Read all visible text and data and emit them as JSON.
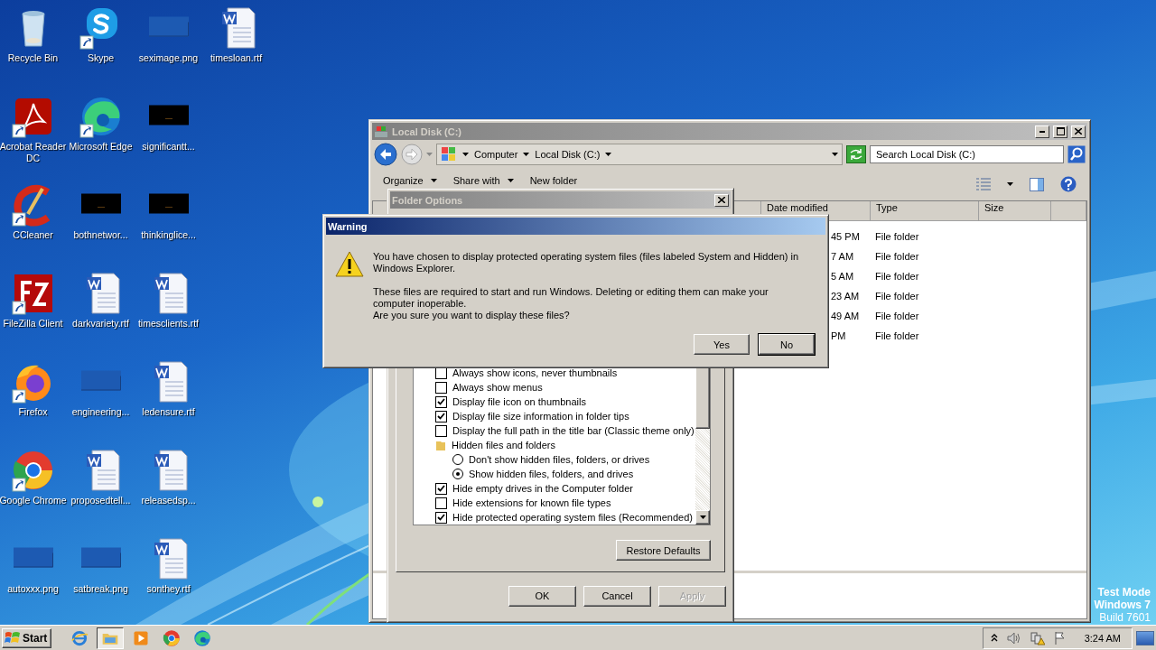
{
  "desktop": {
    "icons": [
      [
        {
          "kind": "recycle",
          "label": "Recycle Bin",
          "shortcut": false
        },
        {
          "kind": "acrobat",
          "label": "Acrobat Reader DC",
          "shortcut": true
        },
        {
          "kind": "ccleaner",
          "label": "CCleaner",
          "shortcut": true
        },
        {
          "kind": "filezilla",
          "label": "FileZilla Client",
          "shortcut": true
        },
        {
          "kind": "firefox",
          "label": "Firefox",
          "shortcut": true
        },
        {
          "kind": "chrome",
          "label": "Google Chrome",
          "shortcut": true
        },
        {
          "kind": "image-blank",
          "label": "autoxxx.png",
          "shortcut": false
        }
      ],
      [
        {
          "kind": "skype",
          "label": "Skype",
          "shortcut": true
        },
        {
          "kind": "edge",
          "label": "Microsoft Edge",
          "shortcut": true
        },
        {
          "kind": "image-dark",
          "label": "bothnetwor...",
          "shortcut": false
        },
        {
          "kind": "word",
          "label": "darkvariety.rtf",
          "shortcut": false
        },
        {
          "kind": "image-blank",
          "label": "engineering...",
          "shortcut": false
        },
        {
          "kind": "word",
          "label": "proposedtell...",
          "shortcut": false
        },
        {
          "kind": "image-blank",
          "label": "satbreak.png",
          "shortcut": false
        }
      ],
      [
        {
          "kind": "image-blank",
          "label": "seximage.png",
          "shortcut": false
        },
        {
          "kind": "image-dark",
          "label": "significantt...",
          "shortcut": false
        },
        {
          "kind": "image-dark",
          "label": "thinkinglice...",
          "shortcut": false
        },
        {
          "kind": "word",
          "label": "timesclients.rtf",
          "shortcut": false
        },
        {
          "kind": "word",
          "label": "ledensure.rtf",
          "shortcut": false
        },
        {
          "kind": "word",
          "label": "releasedsp...",
          "shortcut": false
        },
        {
          "kind": "word",
          "label": "sonthey.rtf",
          "shortcut": false
        }
      ],
      [
        {
          "kind": "word",
          "label": "timesloan.rtf",
          "shortcut": false
        }
      ]
    ]
  },
  "system_notice": [
    {
      "text": "Test Mode",
      "bold": true
    },
    {
      "text": "Windows 7",
      "bold": true
    },
    {
      "text": "Build 7601",
      "bold": false
    }
  ],
  "explorer": {
    "title": "Local Disk (C:)",
    "breadcrumb": [
      "Computer",
      "Local Disk (C:)"
    ],
    "search": {
      "placeholder": "Search Local Disk (C:)"
    },
    "toolbar": [
      {
        "label": "Organize",
        "dropdown": true
      },
      {
        "label": "Share with",
        "dropdown": true
      },
      {
        "label": "New folder",
        "dropdown": false
      }
    ],
    "columns": [
      "Date modified",
      "Type",
      "Size"
    ],
    "rows": [
      {
        "date": "45 PM",
        "type": "File folder"
      },
      {
        "date": "7 AM",
        "type": "File folder"
      },
      {
        "date": "5 AM",
        "type": "File folder"
      },
      {
        "date": "23 AM",
        "type": "File folder"
      },
      {
        "date": "49 AM",
        "type": "File folder"
      },
      {
        "date": "PM",
        "type": "File folder"
      }
    ]
  },
  "folder_options": {
    "title": "Folder Options",
    "settings": [
      {
        "kind": "checkbox",
        "label": "Always show icons, never thumbnails",
        "checked": false
      },
      {
        "kind": "checkbox",
        "label": "Always show menus",
        "checked": false
      },
      {
        "kind": "checkbox",
        "label": "Display file icon on thumbnails",
        "checked": true
      },
      {
        "kind": "checkbox",
        "label": "Display file size information in folder tips",
        "checked": true
      },
      {
        "kind": "checkbox",
        "label": "Display the full path in the title bar (Classic theme only)",
        "checked": false
      },
      {
        "kind": "group",
        "label": "Hidden files and folders"
      },
      {
        "kind": "radio",
        "label": "Don't show hidden files, folders, or drives",
        "selected": false
      },
      {
        "kind": "radio",
        "label": "Show hidden files, folders, and drives",
        "selected": true
      },
      {
        "kind": "checkbox",
        "label": "Hide empty drives in the Computer folder",
        "checked": true
      },
      {
        "kind": "checkbox",
        "label": "Hide extensions for known file types",
        "checked": false
      },
      {
        "kind": "checkbox",
        "label": "Hide protected operating system files (Recommended)",
        "checked": true
      }
    ],
    "restore_button": "Restore Defaults",
    "buttons": [
      {
        "label": "OK",
        "disabled": false
      },
      {
        "label": "Cancel",
        "disabled": false
      },
      {
        "label": "Apply",
        "disabled": true
      }
    ]
  },
  "warning": {
    "title": "Warning",
    "paragraphs": [
      "You have chosen to display protected operating system files (files labeled System and Hidden) in Windows Explorer.",
      "These files are required to start and run Windows. Deleting or editing them can make your computer inoperable."
    ],
    "question": "Are you sure you want to display these files?",
    "buttons": [
      {
        "label": "Yes",
        "focused": false
      },
      {
        "label": "No",
        "focused": true
      }
    ]
  },
  "taskbar": {
    "start": "Start",
    "apps": [
      {
        "kind": "ie",
        "active": false
      },
      {
        "kind": "explorer",
        "active": true
      },
      {
        "kind": "media",
        "active": false
      },
      {
        "kind": "chrome",
        "active": false
      },
      {
        "kind": "edge",
        "active": false
      }
    ],
    "clock": "3:24 AM"
  }
}
